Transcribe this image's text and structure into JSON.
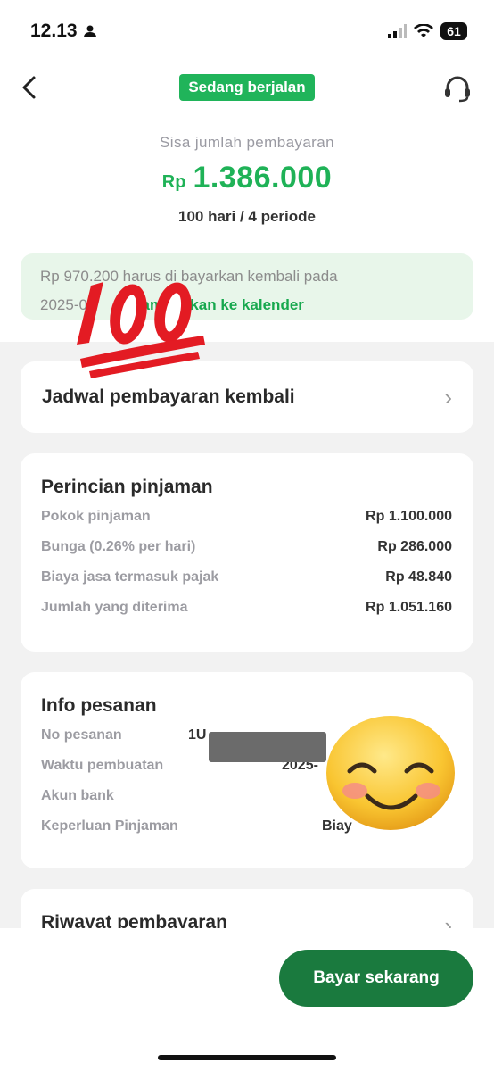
{
  "status_bar": {
    "time": "12.13",
    "battery": "61"
  },
  "header": {
    "status_pill": "Sedang berjalan"
  },
  "summary": {
    "remain_label": "Sisa jumlah pembayaran",
    "currency": "Rp",
    "amount": "1.386.000",
    "period": "100 hari / 4 periode"
  },
  "notice": {
    "text_line1": "Rp 970.200 harus di bayarkan kembali pada",
    "text_line2_prefix": "2025-0",
    "link": "Tambahkan ke kalender"
  },
  "schedule": {
    "title": "Jadwal pembayaran kembali"
  },
  "loan_details": {
    "title": "Perincian pinjaman",
    "rows": [
      {
        "label": "Pokok pinjaman",
        "value": "Rp 1.100.000"
      },
      {
        "label": "Bunga (0.26% per hari)",
        "value": "Rp 286.000"
      },
      {
        "label": "Biaya jasa termasuk pajak",
        "value": "Rp 48.840"
      },
      {
        "label": "Jumlah yang diterima",
        "value": "Rp 1.051.160"
      }
    ]
  },
  "order_info": {
    "title": "Info pesanan",
    "rows": [
      {
        "label": "No pesanan",
        "value": "1U"
      },
      {
        "label": "Waktu pembuatan",
        "value": "2025-"
      },
      {
        "label": "Akun bank",
        "value": ""
      },
      {
        "label": "Keperluan Pinjaman",
        "value": "Biay"
      }
    ]
  },
  "history": {
    "title": "Riwayat pembayaran"
  },
  "bottom": {
    "pay_button": "Bayar sekarang"
  },
  "colors": {
    "accent_green": "#1fb257",
    "button_green": "#1a7a3e",
    "notice_bg": "#e8f6ea"
  }
}
